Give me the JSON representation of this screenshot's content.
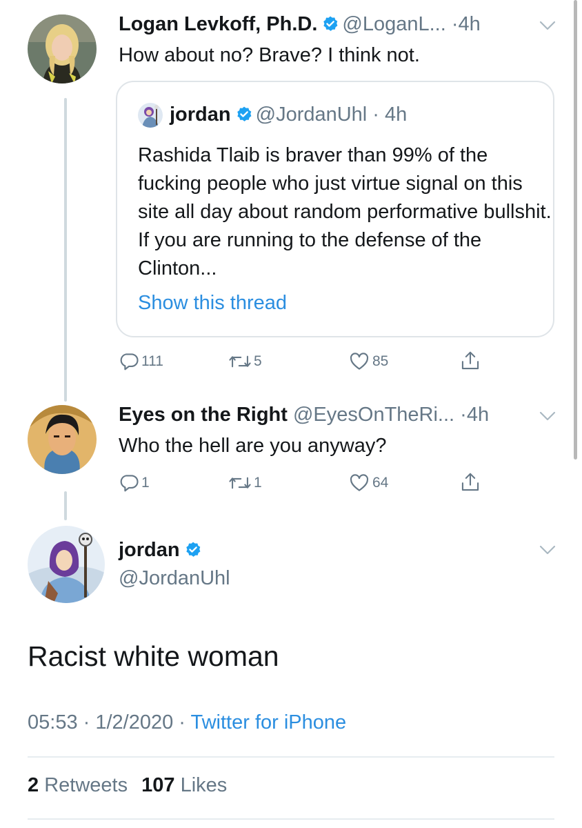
{
  "tweet1": {
    "name": "Logan Levkoff, Ph.D.",
    "handle": "@LoganL...",
    "time": "4h",
    "text": "How about no? Brave? I think not."
  },
  "quote": {
    "name": "jordan",
    "handle": "@JordanUhl",
    "time": "4h",
    "text": "Rashida Tlaib is braver than 99% of the fucking people who just virtue signal on this site all day about random performative bullshit. If you are running to the defense of the Clinton...",
    "show_thread": "Show this thread"
  },
  "tweet1_actions": {
    "replies": "111",
    "retweets": "5",
    "likes": "85"
  },
  "tweet2": {
    "name": "Eyes on the Right",
    "handle": "@EyesOnTheRi...",
    "time": "4h",
    "text": "Who the hell are you anyway?"
  },
  "tweet2_actions": {
    "replies": "1",
    "retweets": "1",
    "likes": "64"
  },
  "main": {
    "name": "jordan",
    "handle": "@JordanUhl",
    "text": "Racist white woman",
    "time": "05:53",
    "date": "1/2/2020",
    "source": "Twitter for iPhone",
    "retweet_count": "2",
    "retweet_label": "Retweets",
    "like_count": "107",
    "like_label": "Likes"
  },
  "colors": {
    "link": "#2b8ee0",
    "verified": "#1da1f2",
    "muted": "#657786"
  }
}
